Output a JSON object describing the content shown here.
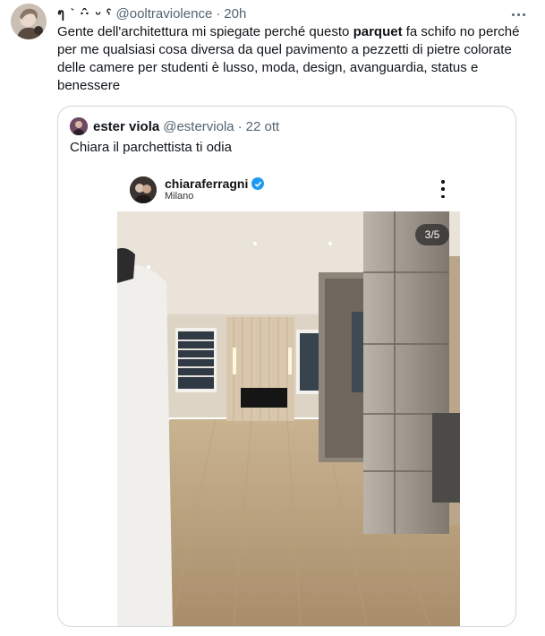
{
  "tweet": {
    "author_name": "ๆ   ˋ  ·̂·  ᵕ ˁ",
    "handle": "@ooltraviolence",
    "separator": "·",
    "time": "20h",
    "text_before": "Gente dell'architettura mi spiegate perché questo ",
    "text_bold": "parquet",
    "text_after": " fa schifo no perché per me qualsiasi cosa diversa da quel pavimento a pezzetti di pietre colorate delle camere per studenti è lusso, moda, design, avanguardia, status e benessere"
  },
  "quote": {
    "author_name": "ester viola",
    "handle": "@esterviola",
    "separator": "·",
    "time": "22 ott",
    "text": "Chiara il parchettista ti odia",
    "embed": {
      "username": "chiaraferragni",
      "location": "Milano",
      "counter": "3/5"
    }
  },
  "icons": {
    "more": "more-horizontal-icon",
    "verified": "verified-badge-icon",
    "ig_more": "more-vertical-icon"
  },
  "colors": {
    "text_primary": "#0f1419",
    "text_secondary": "#536471",
    "border": "#cfd9de",
    "verified_blue": "#1d9bf0"
  }
}
